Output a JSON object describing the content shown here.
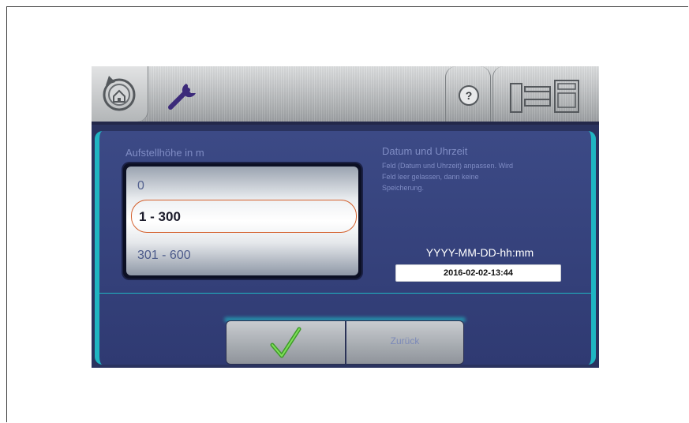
{
  "toolbar": {
    "home_icon": "home-back-icon",
    "wrench_icon": "wrench-icon",
    "help_icon": "help-icon",
    "help_glyph": "?",
    "machine_icon": "machine-layout-icon"
  },
  "altitude": {
    "title": "Aufstellhöhe in m",
    "options": [
      "0",
      "1 - 300",
      "301 - 600"
    ],
    "selected": "1 - 300"
  },
  "datetime": {
    "title": "Datum und Uhrzeit",
    "hint_lines": [
      "Feld (Datum und Uhrzeit) anpassen. Wird",
      "Feld leer gelassen, dann keine",
      "Speicherung."
    ],
    "format": "YYYY-MM-DD-hh:mm",
    "value": "2016-02-02-13:44"
  },
  "actions": {
    "confirm_icon": "checkmark-icon",
    "back_label": "Zurück"
  },
  "colors": {
    "accent": "#1fb5c2",
    "panel": "#2f3a72",
    "selection_border": "#d4602c",
    "check_green": "#5fbf3a"
  }
}
